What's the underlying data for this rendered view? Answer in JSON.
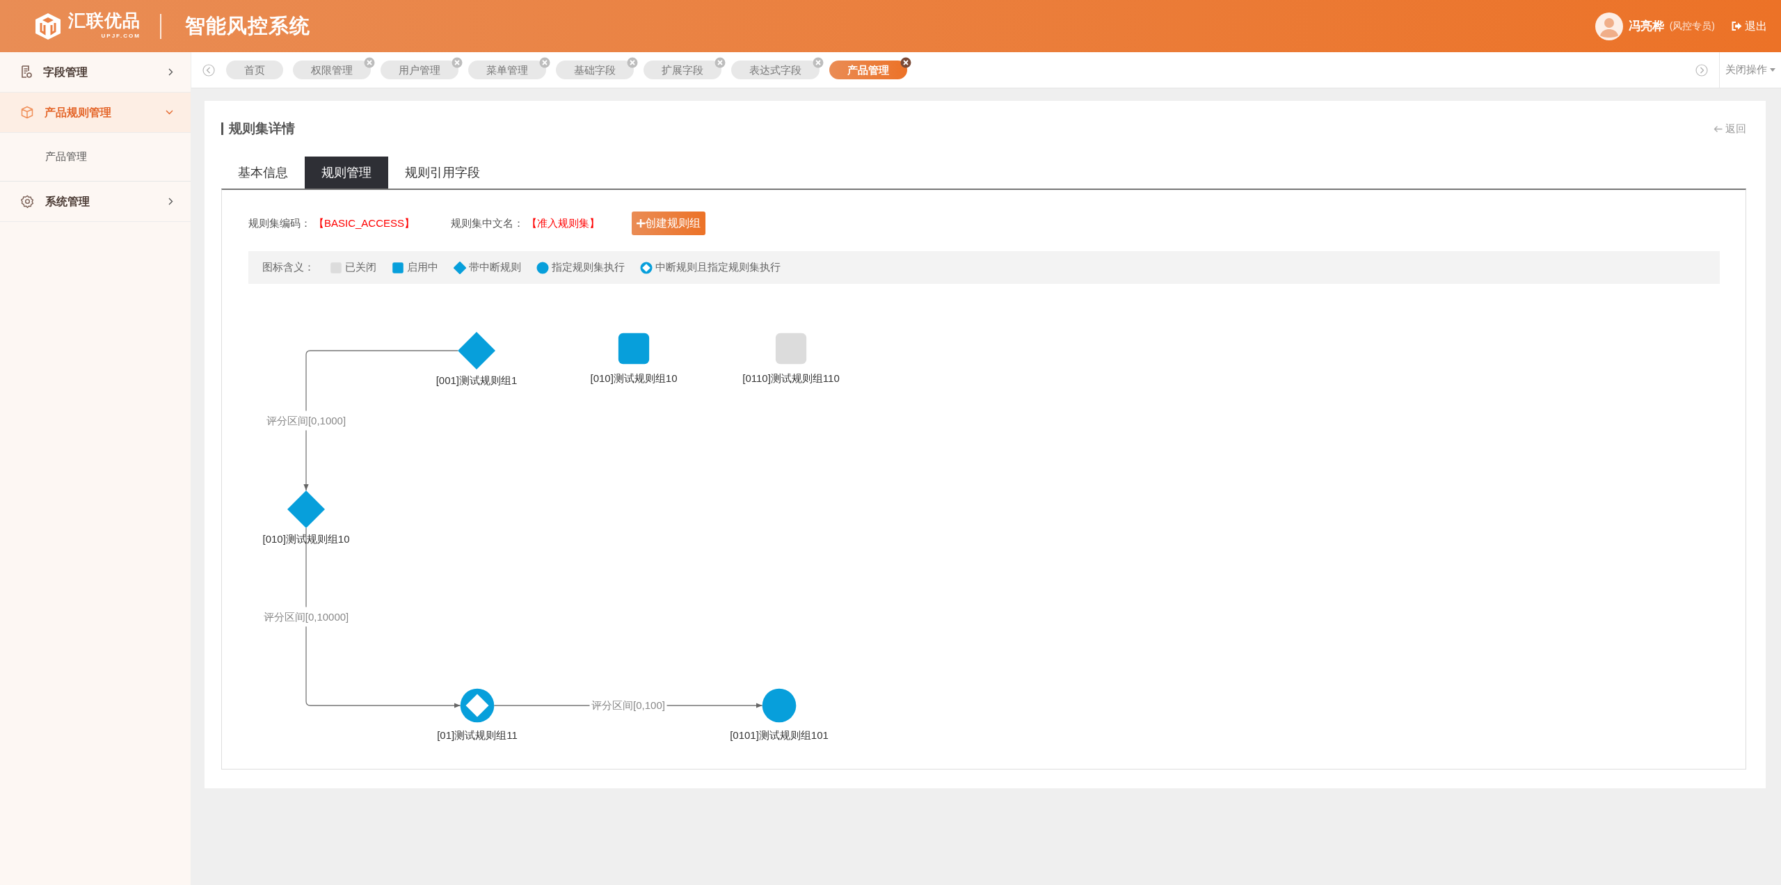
{
  "header": {
    "logo_text": "汇联优品",
    "logo_subtext": "UPJF.COM",
    "title": "智能风控系统",
    "user": {
      "name": "冯亮桦",
      "role": "(风控专员)"
    },
    "logout": "退出"
  },
  "sidebar": {
    "items": [
      {
        "label": "字段管理",
        "expanded": false,
        "selected": false
      },
      {
        "label": "产品规则管理",
        "expanded": true,
        "selected": true,
        "children": [
          {
            "label": "产品管理",
            "selected": false
          }
        ]
      },
      {
        "label": "系统管理",
        "expanded": false,
        "selected": false
      }
    ]
  },
  "tabs_bar": {
    "tabs": [
      {
        "label": "首页",
        "selected": false,
        "closable": false
      },
      {
        "label": "权限管理",
        "selected": false,
        "closable": true
      },
      {
        "label": "用户管理",
        "selected": false,
        "closable": true
      },
      {
        "label": "菜单管理",
        "selected": false,
        "closable": true
      },
      {
        "label": "基础字段",
        "selected": false,
        "closable": true
      },
      {
        "label": "扩展字段",
        "selected": false,
        "closable": true
      },
      {
        "label": "表达式字段",
        "selected": false,
        "closable": true
      },
      {
        "label": "产品管理",
        "selected": true,
        "closable": true
      }
    ],
    "close_menu": "关闭操作"
  },
  "page": {
    "title": "规则集详情",
    "back": "返回",
    "tabs": [
      {
        "label": "基本信息",
        "selected": false
      },
      {
        "label": "规则管理",
        "selected": true
      },
      {
        "label": "规则引用字段",
        "selected": false
      }
    ],
    "info": [
      {
        "label": "规则集编码：",
        "value": "【BASIC_ACCESS】"
      },
      {
        "label": "规则集中文名：",
        "value": "【准入规则集】"
      }
    ],
    "create_button": "创建规则组",
    "legend": {
      "label": "图标含义：",
      "items": [
        {
          "kind": "closed",
          "label": "已关闭"
        },
        {
          "kind": "active",
          "label": "启用中"
        },
        {
          "kind": "interrupt",
          "label": "带中断规则"
        },
        {
          "kind": "assign",
          "label": "指定规则集执行"
        },
        {
          "kind": "interrupt_assign",
          "label": "中断规则且指定规则集执行"
        }
      ]
    },
    "diagram": {
      "nodes": [
        {
          "kind": "interrupt",
          "label": "[001]测试规则组1"
        },
        {
          "kind": "active",
          "label": "[010]测试规则组10"
        },
        {
          "kind": "closed",
          "label": "[0110]测试规则组110"
        },
        {
          "kind": "interrupt",
          "label": "[010]测试规则组10"
        },
        {
          "kind": "interrupt_assign",
          "label": "[01]测试规则组11"
        },
        {
          "kind": "assign",
          "label": "[0101]测试规则组101"
        }
      ],
      "edges": [
        {
          "label": "评分区间[0,1000]"
        },
        {
          "label": "评分区间[0,10000]"
        },
        {
          "label": "评分区间[0,100]"
        }
      ]
    }
  }
}
